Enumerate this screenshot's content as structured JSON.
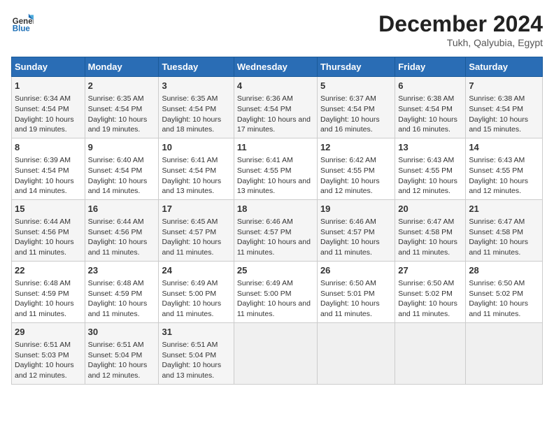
{
  "logo": {
    "line1": "General",
    "line2": "Blue"
  },
  "title": "December 2024",
  "subtitle": "Tukh, Qalyubia, Egypt",
  "days_of_week": [
    "Sunday",
    "Monday",
    "Tuesday",
    "Wednesday",
    "Thursday",
    "Friday",
    "Saturday"
  ],
  "weeks": [
    [
      {
        "day": 1,
        "sunrise": "6:34 AM",
        "sunset": "4:54 PM",
        "daylight": "10 hours and 19 minutes."
      },
      {
        "day": 2,
        "sunrise": "6:35 AM",
        "sunset": "4:54 PM",
        "daylight": "10 hours and 19 minutes."
      },
      {
        "day": 3,
        "sunrise": "6:35 AM",
        "sunset": "4:54 PM",
        "daylight": "10 hours and 18 minutes."
      },
      {
        "day": 4,
        "sunrise": "6:36 AM",
        "sunset": "4:54 PM",
        "daylight": "10 hours and 17 minutes."
      },
      {
        "day": 5,
        "sunrise": "6:37 AM",
        "sunset": "4:54 PM",
        "daylight": "10 hours and 16 minutes."
      },
      {
        "day": 6,
        "sunrise": "6:38 AM",
        "sunset": "4:54 PM",
        "daylight": "10 hours and 16 minutes."
      },
      {
        "day": 7,
        "sunrise": "6:38 AM",
        "sunset": "4:54 PM",
        "daylight": "10 hours and 15 minutes."
      }
    ],
    [
      {
        "day": 8,
        "sunrise": "6:39 AM",
        "sunset": "4:54 PM",
        "daylight": "10 hours and 14 minutes."
      },
      {
        "day": 9,
        "sunrise": "6:40 AM",
        "sunset": "4:54 PM",
        "daylight": "10 hours and 14 minutes."
      },
      {
        "day": 10,
        "sunrise": "6:41 AM",
        "sunset": "4:54 PM",
        "daylight": "10 hours and 13 minutes."
      },
      {
        "day": 11,
        "sunrise": "6:41 AM",
        "sunset": "4:55 PM",
        "daylight": "10 hours and 13 minutes."
      },
      {
        "day": 12,
        "sunrise": "6:42 AM",
        "sunset": "4:55 PM",
        "daylight": "10 hours and 12 minutes."
      },
      {
        "day": 13,
        "sunrise": "6:43 AM",
        "sunset": "4:55 PM",
        "daylight": "10 hours and 12 minutes."
      },
      {
        "day": 14,
        "sunrise": "6:43 AM",
        "sunset": "4:55 PM",
        "daylight": "10 hours and 12 minutes."
      }
    ],
    [
      {
        "day": 15,
        "sunrise": "6:44 AM",
        "sunset": "4:56 PM",
        "daylight": "10 hours and 11 minutes."
      },
      {
        "day": 16,
        "sunrise": "6:44 AM",
        "sunset": "4:56 PM",
        "daylight": "10 hours and 11 minutes."
      },
      {
        "day": 17,
        "sunrise": "6:45 AM",
        "sunset": "4:57 PM",
        "daylight": "10 hours and 11 minutes."
      },
      {
        "day": 18,
        "sunrise": "6:46 AM",
        "sunset": "4:57 PM",
        "daylight": "10 hours and 11 minutes."
      },
      {
        "day": 19,
        "sunrise": "6:46 AM",
        "sunset": "4:57 PM",
        "daylight": "10 hours and 11 minutes."
      },
      {
        "day": 20,
        "sunrise": "6:47 AM",
        "sunset": "4:58 PM",
        "daylight": "10 hours and 11 minutes."
      },
      {
        "day": 21,
        "sunrise": "6:47 AM",
        "sunset": "4:58 PM",
        "daylight": "10 hours and 11 minutes."
      }
    ],
    [
      {
        "day": 22,
        "sunrise": "6:48 AM",
        "sunset": "4:59 PM",
        "daylight": "10 hours and 11 minutes."
      },
      {
        "day": 23,
        "sunrise": "6:48 AM",
        "sunset": "4:59 PM",
        "daylight": "10 hours and 11 minutes."
      },
      {
        "day": 24,
        "sunrise": "6:49 AM",
        "sunset": "5:00 PM",
        "daylight": "10 hours and 11 minutes."
      },
      {
        "day": 25,
        "sunrise": "6:49 AM",
        "sunset": "5:00 PM",
        "daylight": "10 hours and 11 minutes."
      },
      {
        "day": 26,
        "sunrise": "6:50 AM",
        "sunset": "5:01 PM",
        "daylight": "10 hours and 11 minutes."
      },
      {
        "day": 27,
        "sunrise": "6:50 AM",
        "sunset": "5:02 PM",
        "daylight": "10 hours and 11 minutes."
      },
      {
        "day": 28,
        "sunrise": "6:50 AM",
        "sunset": "5:02 PM",
        "daylight": "10 hours and 11 minutes."
      }
    ],
    [
      {
        "day": 29,
        "sunrise": "6:51 AM",
        "sunset": "5:03 PM",
        "daylight": "10 hours and 12 minutes."
      },
      {
        "day": 30,
        "sunrise": "6:51 AM",
        "sunset": "5:04 PM",
        "daylight": "10 hours and 12 minutes."
      },
      {
        "day": 31,
        "sunrise": "6:51 AM",
        "sunset": "5:04 PM",
        "daylight": "10 hours and 13 minutes."
      },
      null,
      null,
      null,
      null
    ]
  ]
}
